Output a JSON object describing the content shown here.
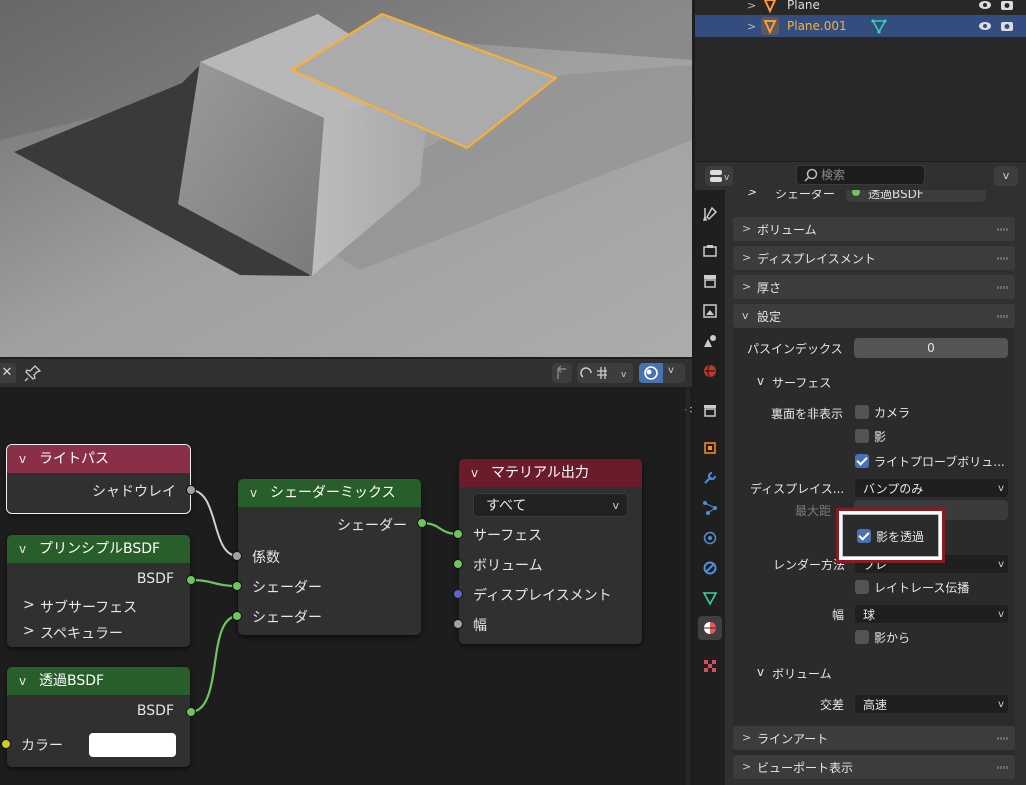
{
  "outliner": {
    "rows": [
      {
        "name": "Plane",
        "selected": false
      },
      {
        "name": "Plane.001",
        "selected": true
      }
    ]
  },
  "properties": {
    "search_placeholder": "検索",
    "panels": {
      "shader": "シェーダー",
      "shader_value": "透過BSDF",
      "volume": "ボリューム",
      "displacement": "ディスプレイスメント",
      "thickness": "厚さ",
      "settings": "設定",
      "lineart": "ラインアート",
      "viewport_display": "ビューポート表示"
    },
    "settings": {
      "pass_index_label": "パスインデックス",
      "pass_index_value": "0",
      "surface_header": "サーフェス",
      "backface_label": "裏面を非表示",
      "camera": "カメラ",
      "shadow": "影",
      "light_probe": "ライトプローブボリュ...",
      "displacement_label": "ディスプレイス...",
      "displacement_value": "バンプのみ",
      "max_distance_label": "最大距",
      "transparent_shadow": "影を透過",
      "render_method_label": "レンダー方法",
      "render_method_value": "ブレ",
      "raytrace": "レイトレース伝播",
      "width_label": "幅",
      "width_value": "球",
      "from_shadow": "影から",
      "volume_header": "ボリューム",
      "intersection_label": "交差",
      "intersection_value": "高速"
    },
    "checks": {
      "camera": false,
      "shadow": false,
      "light_probe": true,
      "transparent_shadow": true,
      "raytrace": false,
      "from_shadow": false
    }
  },
  "nodes": {
    "light_path": {
      "title": "ライトパス",
      "out_shadow_ray": "シャドウレイ"
    },
    "principled": {
      "title": "プリンシプルBSDF",
      "out_bsdf": "BSDF",
      "subsurface": "サブサーフェス",
      "specular": "スペキュラー"
    },
    "transparent": {
      "title": "透過BSDF",
      "out_bsdf": "BSDF",
      "color": "カラー"
    },
    "mix": {
      "title": "シェーダーミックス",
      "out_shader": "シェーダー",
      "in_fac": "係数",
      "in_shader1": "シェーダー",
      "in_shader2": "シェーダー"
    },
    "output": {
      "title": "マテリアル出力",
      "target": "すべて",
      "surface": "サーフェス",
      "volume": "ボリューム",
      "displacement": "ディスプレイスメント",
      "thickness": "幅"
    }
  },
  "colors": {
    "selection_orange": "#ffaf29",
    "shader_socket": "#6ec55e",
    "highlight_box": "#8b1a22",
    "checkbox_on": "#4772b3"
  }
}
